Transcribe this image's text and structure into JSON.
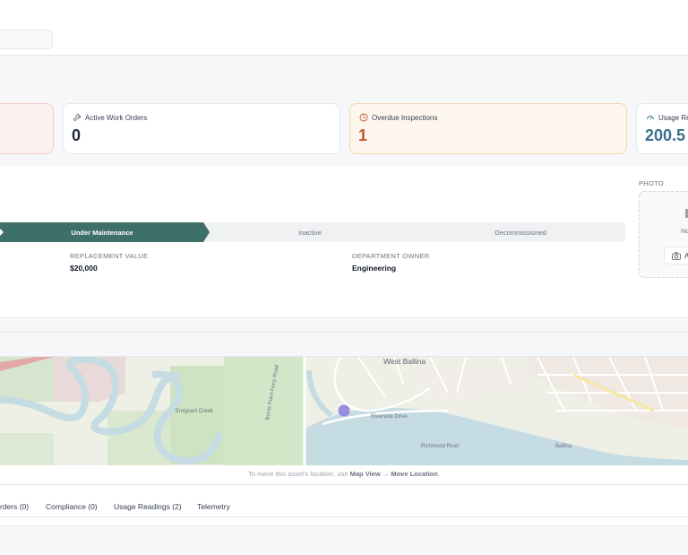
{
  "stats": {
    "active_work_orders": {
      "label": "Active Work Orders",
      "value": "0",
      "icon": "wrench-icon"
    },
    "overdue_inspections": {
      "label": "Overdue Inspections",
      "value": "1",
      "icon": "clock-icon"
    },
    "usage": {
      "label": "Usage Rea",
      "value": "200.5",
      "icon": "gauge-icon"
    }
  },
  "lifecycle": {
    "steps": [
      "Under Maintenance",
      "Inactive",
      "Decommissioned"
    ],
    "active_step": "Under Maintenance"
  },
  "fields": {
    "replacement_value": {
      "label": "REPLACEMENT VALUE",
      "value": "$20,000"
    },
    "department_owner": {
      "label": "DEPARTMENT OWNER",
      "value": "Engineering"
    }
  },
  "photo": {
    "label": "PHOTO",
    "empty_text": "No",
    "button_label": "A"
  },
  "map": {
    "labels": {
      "west_ballina": "West Ballina",
      "riverside_drive": "Riverside Drive",
      "richmond_river": "Richmond River",
      "emigrant_creek": "Emigrant Creek",
      "burns_point_ferry_road": "Burns Point Ferry Road",
      "ballina": "Ballina"
    },
    "colors": {
      "water": "#c6dce3",
      "park": "#cde3c2",
      "marker": "#8b7ddf"
    }
  },
  "hint": {
    "prefix": "To move this asset's location, use ",
    "action": "Map View → Move Location",
    "suffix": "."
  },
  "tabs": [
    "rders (0)",
    "Compliance (0)",
    "Usage Readings (2)",
    "Telemetry"
  ]
}
